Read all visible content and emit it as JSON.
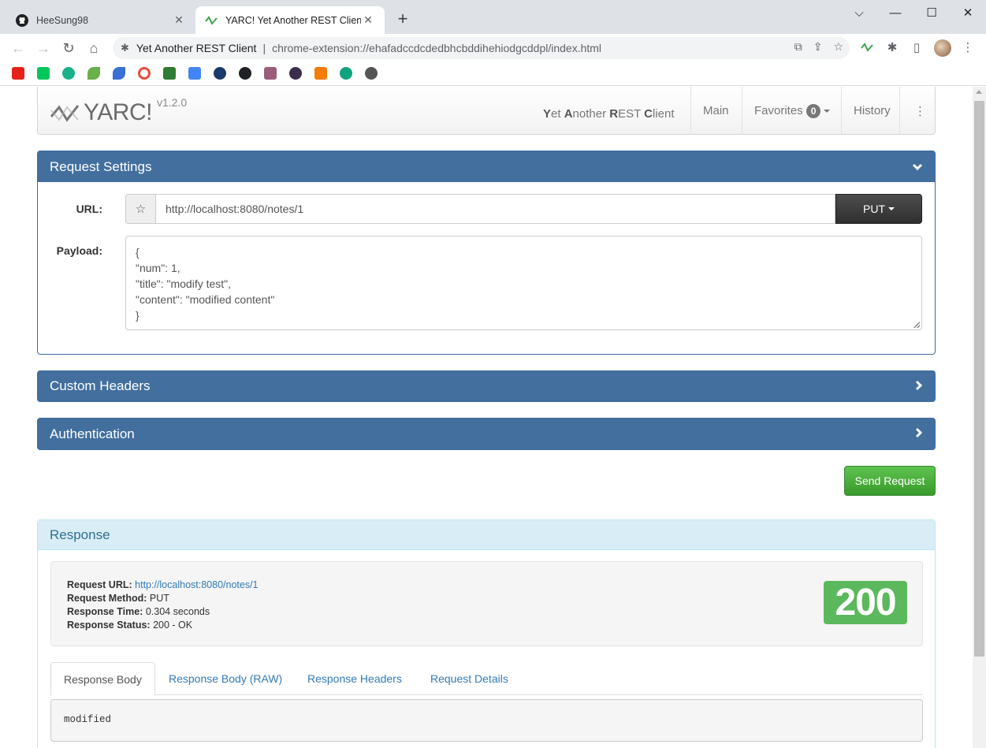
{
  "browser": {
    "tabs": [
      {
        "title": "HeeSung98",
        "icon": "github-icon",
        "active": false
      },
      {
        "title": "YARC! Yet Another REST Client",
        "icon": "yarc-icon",
        "active": true
      }
    ],
    "omnibox": {
      "site": "Yet Another REST Client",
      "url": "chrome-extension://ehafadccdcdedbhcbddihehiodgcddpl/index.html"
    }
  },
  "app": {
    "brand": "YARC!",
    "version": "v1.2.0",
    "tagline_parts": [
      "Y",
      "et ",
      "A",
      "nother ",
      "R",
      "EST ",
      "C",
      "lient"
    ],
    "nav": {
      "main": "Main",
      "favorites": "Favorites",
      "favorites_count": "0",
      "history": "History",
      "more": "⋮"
    }
  },
  "request_settings": {
    "title": "Request Settings",
    "url_label": "URL:",
    "url_value": "http://localhost:8080/notes/1",
    "method": "PUT",
    "payload_label": "Payload:",
    "payload": "{\n\"num\": 1,\n\"title\": \"modify test\",\n\"content\": \"modified content\"\n}"
  },
  "custom_headers": {
    "title": "Custom Headers"
  },
  "authentication": {
    "title": "Authentication"
  },
  "send_button": "Send Request",
  "response": {
    "title": "Response",
    "request_url_label": "Request URL:",
    "request_url": "http://localhost:8080/notes/1",
    "request_method_label": "Request Method:",
    "request_method": "PUT",
    "response_time_label": "Response Time:",
    "response_time": "0.304 seconds",
    "response_status_label": "Response Status:",
    "response_status": "200 - OK",
    "status_code": "200",
    "tabs": [
      "Response Body",
      "Response Body (RAW)",
      "Response Headers",
      "Request Details"
    ],
    "body": "modified"
  }
}
